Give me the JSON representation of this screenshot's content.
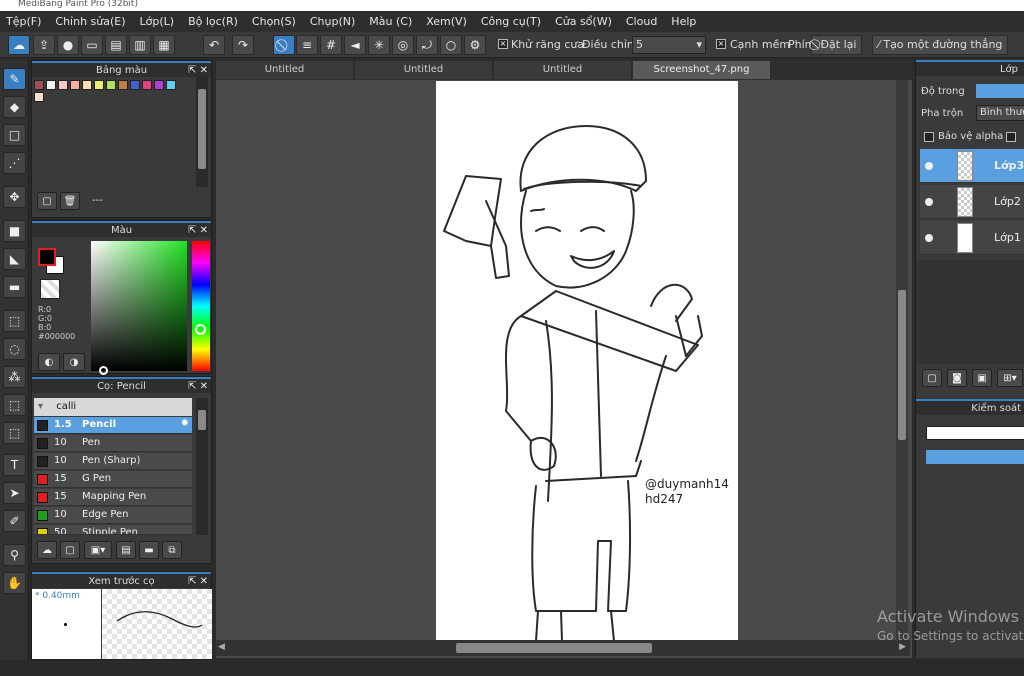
{
  "window": {
    "title": "MediBang Paint Pro (32bit)"
  },
  "menu": [
    "Tệp(F)",
    "Chỉnh sửa(E)",
    "Lớp(L)",
    "Bộ lọc(R)",
    "Chọn(S)",
    "Chụp(N)",
    "Màu (C)",
    "Xem(V)",
    "Công cụ(T)",
    "Cửa sổ(W)",
    "Cloud",
    "Help"
  ],
  "toolbar": {
    "antialias_label": "Khử răng cưa",
    "antialias_checked": "×",
    "adjust_label": "Điều chỉnh",
    "adjust_value": "5",
    "smooth_label": "Cạnh mềm",
    "smooth_checked": "×",
    "key_label": "Phím",
    "reset_label": "Đặt lại",
    "line_label": "Tạo một đường thẳng"
  },
  "palette_panel": {
    "title": "Bảng màu",
    "name_field": "---"
  },
  "color_panel": {
    "title": "Màu",
    "r": "R:0",
    "g": "G:0",
    "b": "B:0",
    "hex": "#000000",
    "fg_color": "#000000",
    "bg_color": "#ffffff"
  },
  "brush_panel": {
    "title": "Cọ: Pencil",
    "group": "calli",
    "brushes": [
      {
        "size": "1.5",
        "name": "Pencil",
        "color": "#222222",
        "selected": true
      },
      {
        "size": "10",
        "name": "Pen",
        "color": "#222222"
      },
      {
        "size": "10",
        "name": "Pen (Sharp)",
        "color": "#222222"
      },
      {
        "size": "15",
        "name": "G Pen",
        "color": "#e02020"
      },
      {
        "size": "15",
        "name": "Mapping Pen",
        "color": "#e02020"
      },
      {
        "size": "10",
        "name": "Edge Pen",
        "color": "#20a020"
      },
      {
        "size": "50",
        "name": "Stipple Pen",
        "color": "#e0d000"
      }
    ]
  },
  "preview_panel": {
    "title": "Xem trước cọ",
    "size": "* 0.40mm"
  },
  "tabs": [
    "Untitled",
    "Untitled",
    "Untitled",
    "Screenshot_47.png"
  ],
  "canvas": {
    "watermark_line1": "@duymanh14",
    "watermark_line2": "hd247"
  },
  "layer_panel": {
    "title": "Lớp",
    "opacity_label": "Độ trong",
    "blend_label": "Pha trộn",
    "blend_value": "Bình thường",
    "protect_alpha_label": "Bảo vệ alpha",
    "layers": [
      {
        "name": "Lớp3",
        "selected": true
      },
      {
        "name": "Lớp2"
      },
      {
        "name": "Lớp1"
      }
    ],
    "control_title": "Kiểm soát"
  },
  "os_overlay": {
    "line1": "Activate Windows",
    "line2": "Go to Settings to activate"
  }
}
